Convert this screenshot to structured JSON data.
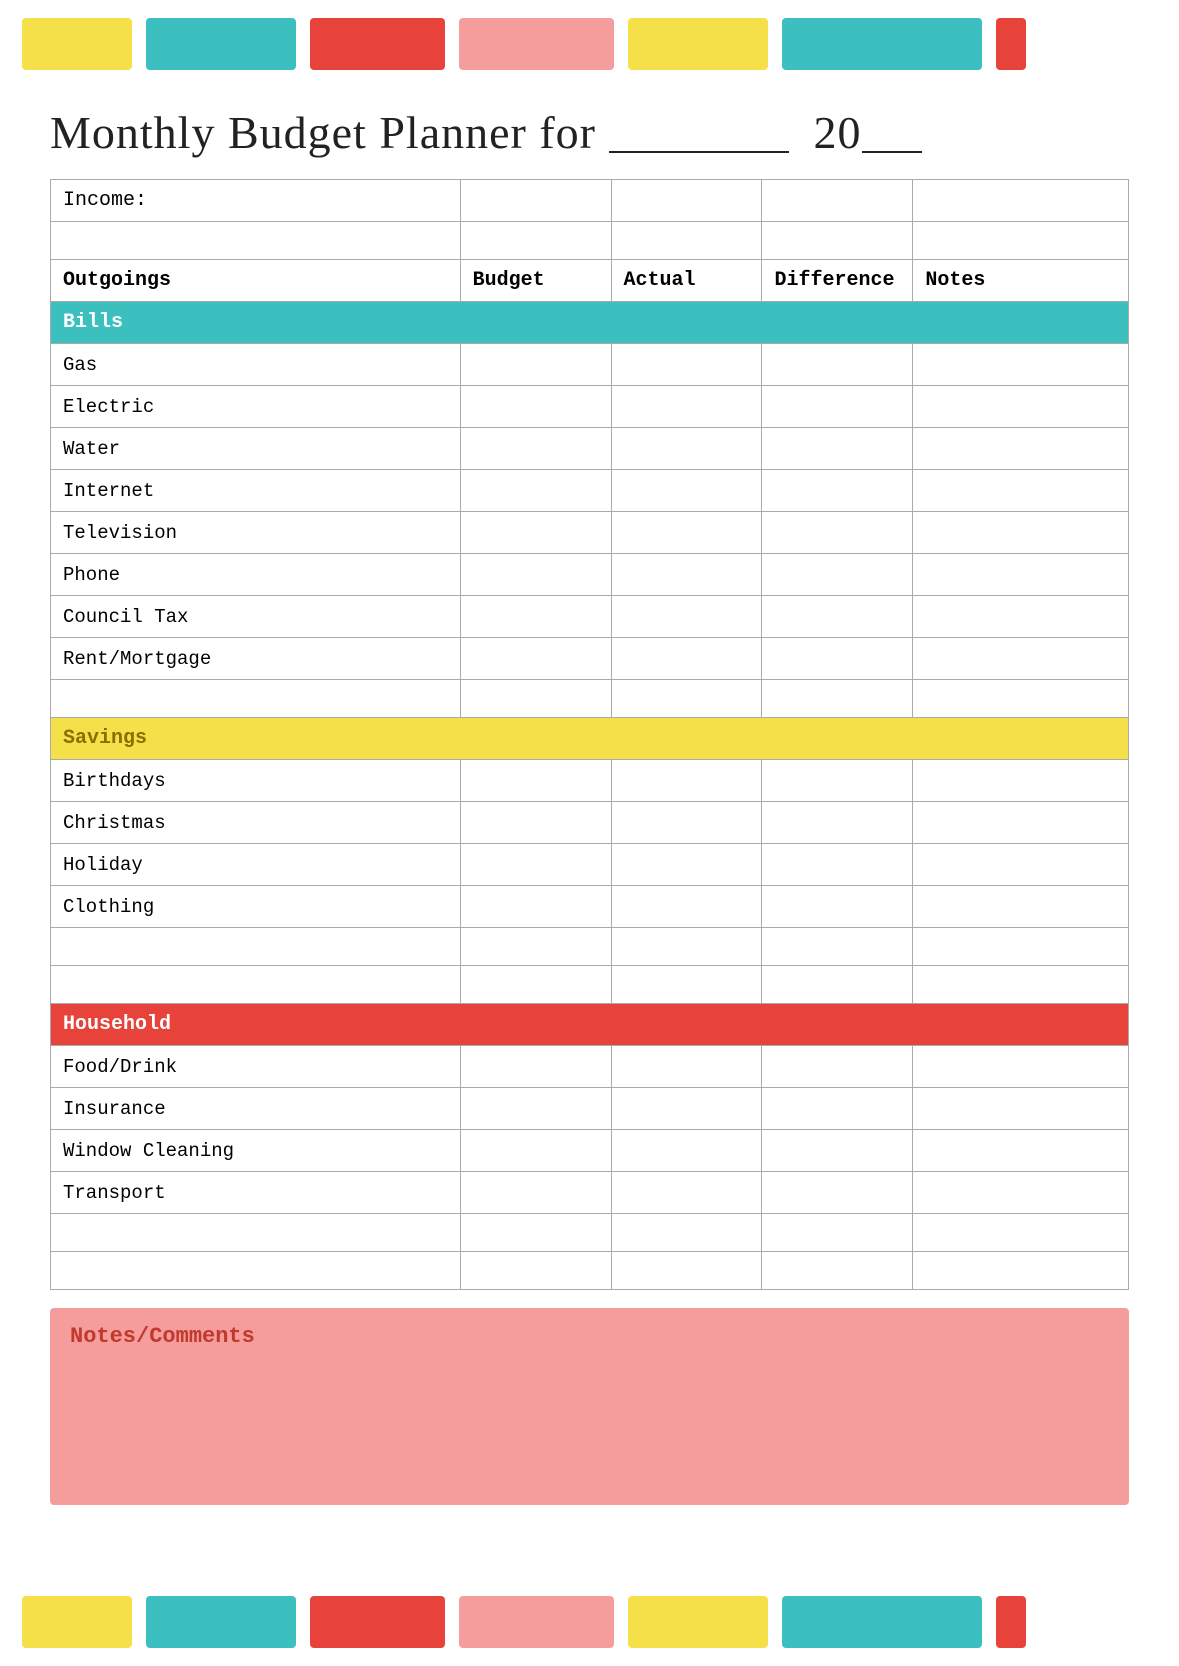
{
  "title": {
    "main": "Monthly Budget Planner for",
    "year_prefix": "20",
    "year_suffix": "__"
  },
  "top_bars": [
    {
      "color": "yellow",
      "label": "yellow-bar-1"
    },
    {
      "color": "teal",
      "label": "teal-bar-1"
    },
    {
      "color": "red",
      "label": "red-bar-1"
    },
    {
      "color": "pink",
      "label": "pink-bar-1"
    },
    {
      "color": "yellow",
      "label": "yellow-bar-2"
    },
    {
      "color": "teal",
      "label": "teal-bar-2"
    },
    {
      "color": "red-small",
      "label": "red-bar-small"
    }
  ],
  "table": {
    "income_label": "Income:",
    "columns": {
      "outgoings": "Outgoings",
      "budget": "Budget",
      "actual": "Actual",
      "difference": "Difference",
      "notes": "Notes"
    },
    "sections": {
      "bills": {
        "label": "Bills",
        "items": [
          "Gas",
          "Electric",
          "Water",
          "Internet",
          "Television",
          "Phone",
          "Council Tax",
          "Rent/Mortgage"
        ]
      },
      "savings": {
        "label": "Savings",
        "items": [
          "Birthdays",
          "Christmas",
          "Holiday",
          "Clothing"
        ]
      },
      "household": {
        "label": "Household",
        "items": [
          "Food/Drink",
          "Insurance",
          "Window Cleaning",
          "Transport"
        ]
      }
    }
  },
  "notes_comments": {
    "label": "Notes/Comments"
  }
}
